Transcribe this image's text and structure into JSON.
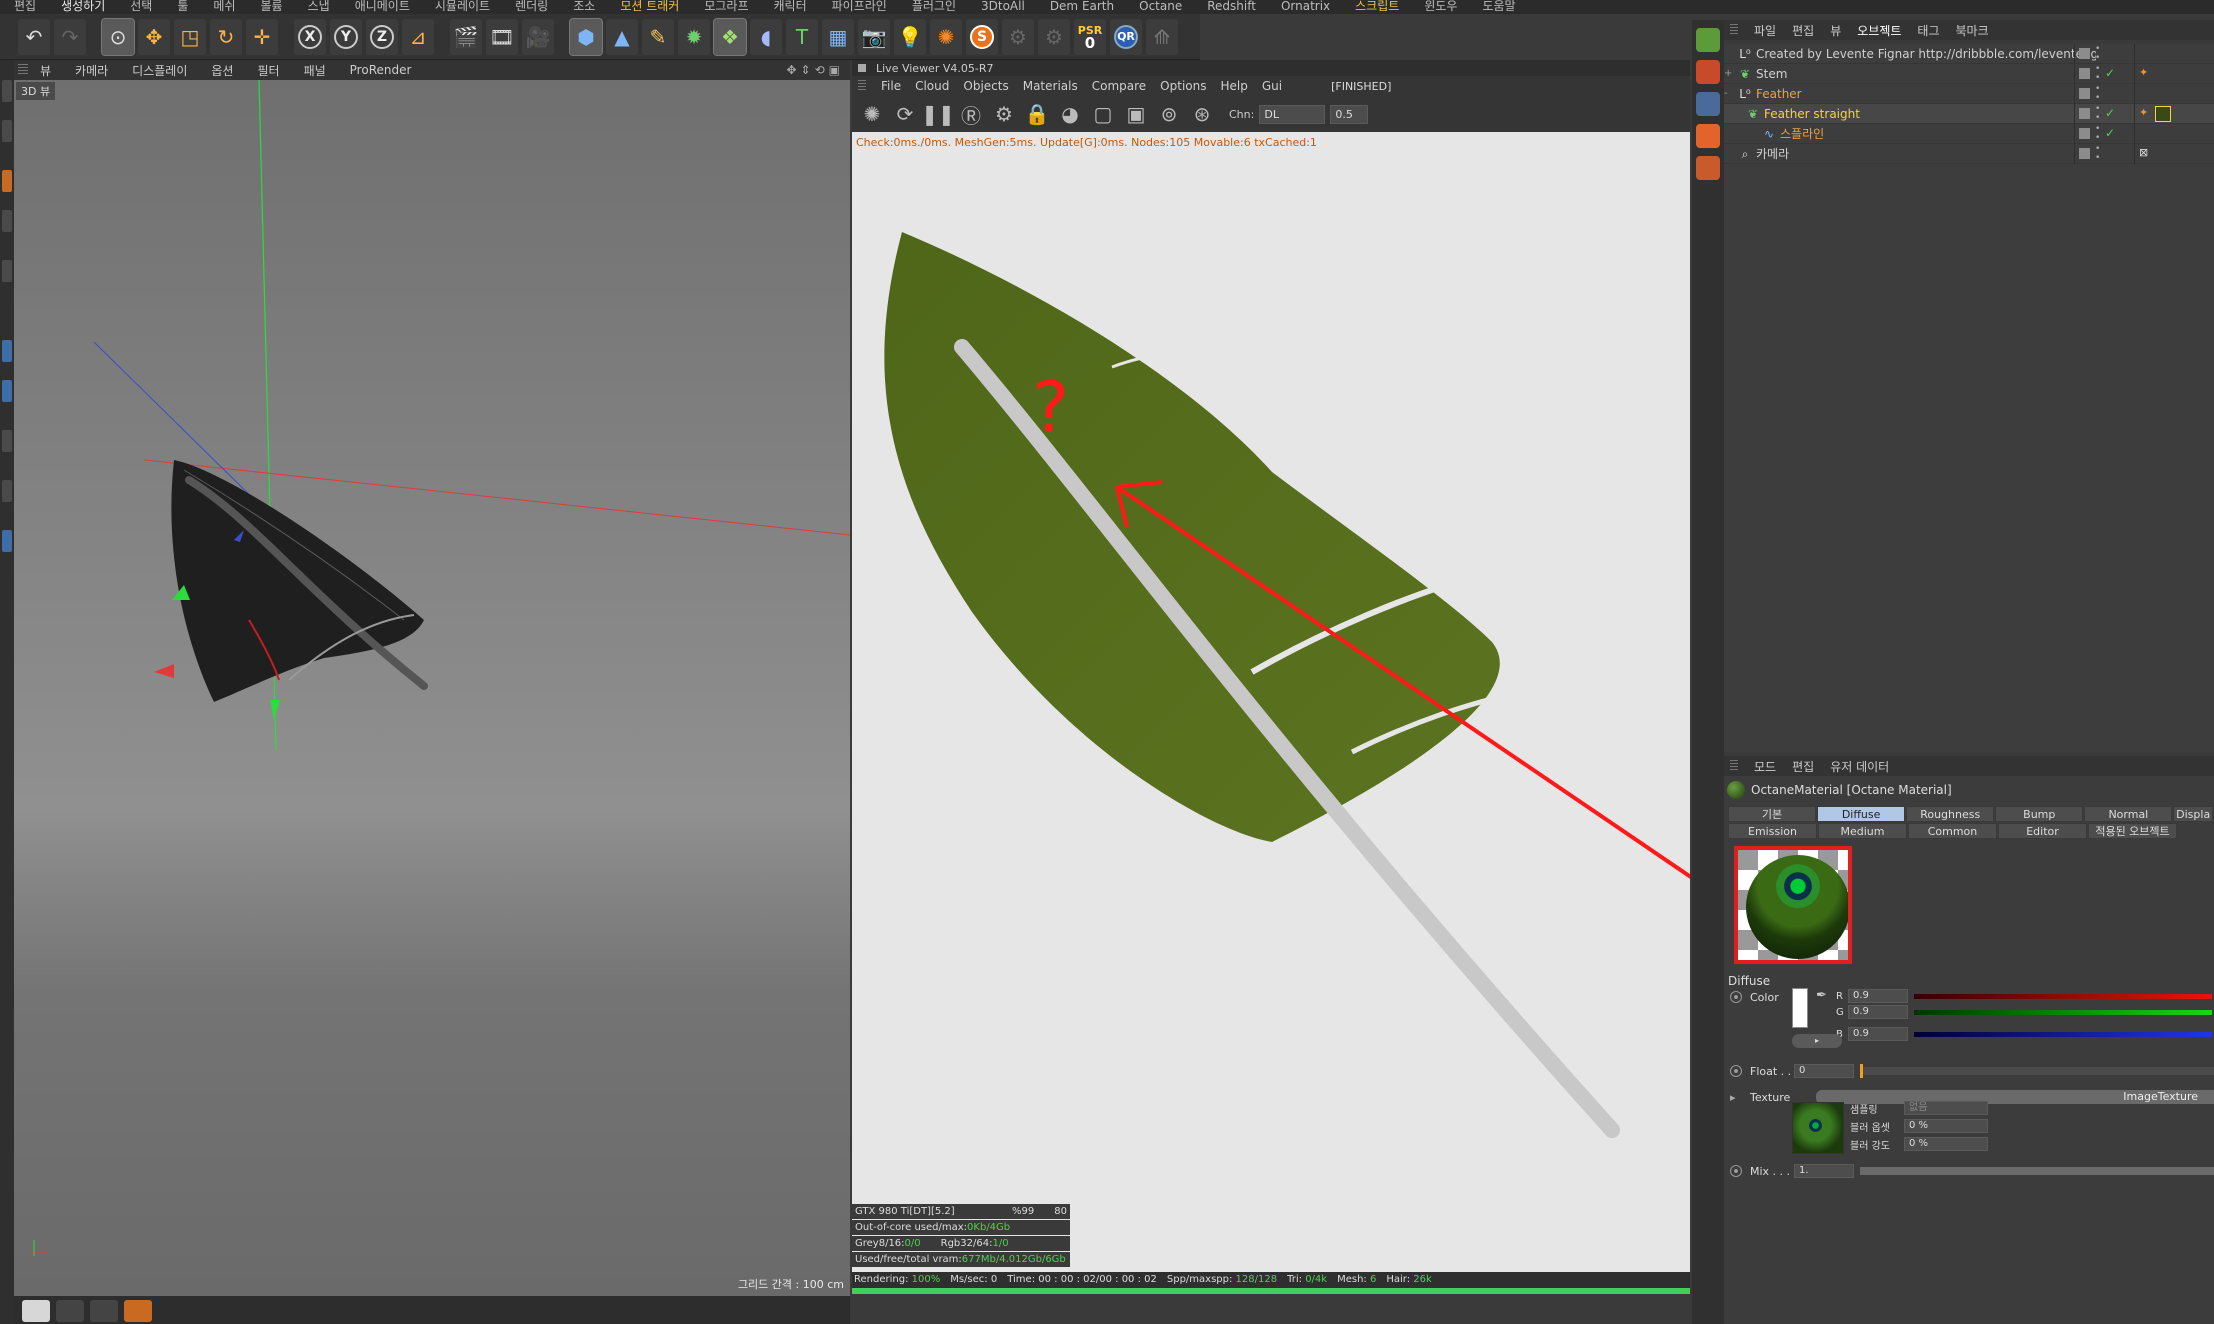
{
  "menubar": [
    "편집",
    "생성하기",
    "선택",
    "툴",
    "메쉬",
    "볼륨",
    "스냅",
    "애니메이트",
    "시뮬레이트",
    "렌더링",
    "조소",
    "모션 트래커",
    "모그라프",
    "캐릭터",
    "파이프라인",
    "플러그인",
    "3DtoAll",
    "Dem Earth",
    "Octane",
    "Redshift",
    "Ornatrix",
    "스크립트",
    "윈도우",
    "도움말"
  ],
  "toolbar": {
    "axis_x": "X",
    "axis_y": "Y",
    "axis_z": "Z",
    "psr_label": "PSR",
    "psr_value": "0",
    "qr_label": "QR",
    "s_label": "S"
  },
  "viewport": {
    "menu": [
      "뷰",
      "카메라",
      "디스플레이",
      "옵션",
      "필터",
      "패널",
      "ProRender"
    ],
    "label": "3D 뷰",
    "grid_text": "그리드 간격 : 100 cm"
  },
  "live_viewer": {
    "title": "Live Viewer V4.05-R7",
    "menu": [
      "File",
      "Cloud",
      "Objects",
      "Materials",
      "Compare",
      "Options",
      "Help",
      "Gui"
    ],
    "status_tag": "[FINISHED]",
    "chn_label": "Chn:",
    "chn_value": "DL",
    "chn_num": "0.5",
    "check_text": "Check:0ms./0ms. MeshGen:5ms. Update[G]:0ms. Nodes:105 Movable:6 txCached:1",
    "annotation": "?",
    "gpu": {
      "card": "GTX 980 Ti[DT][5.2]",
      "pct": "%99",
      "temp": "80",
      "ooc_label": "Out-of-core used/max:",
      "ooc_value": "0Kb/4Gb",
      "grey_label": "Grey8/16:",
      "grey_value": "0/0",
      "rgb_label": "Rgb32/64:",
      "rgb_value": "1/0",
      "vram_label": "Used/free/total vram:",
      "vram_value": "677Mb/4.012Gb/6Gb"
    },
    "status": {
      "rendering_label": "Rendering:",
      "rendering_value": "100%",
      "mssec_label": "Ms/sec:",
      "mssec_value": "0",
      "time_label": "Time:",
      "time_value": "00 : 00 : 02/00 : 00 : 02",
      "spp_label": "Spp/maxspp:",
      "spp_value": "128/128",
      "tri_label": "Tri:",
      "tri_value": "0/4k",
      "mesh_label": "Mesh:",
      "mesh_value": "6",
      "hair_label": "Hair:",
      "hair_value": "26k"
    }
  },
  "object_manager": {
    "menu": [
      "파일",
      "편집",
      "뷰",
      "오브젝트",
      "태그",
      "북마크"
    ],
    "rows": [
      {
        "name": "Created by Levente Fignar http://dribbble.com/leventefignar",
        "depth": 0,
        "icon": "null-icon",
        "expand": "",
        "color": "normal"
      },
      {
        "name": "Stem",
        "depth": 0,
        "icon": "spline-object-icon",
        "expand": "+",
        "color": "normal"
      },
      {
        "name": "Feather",
        "depth": 0,
        "icon": "null-icon",
        "expand": "-",
        "color": "orange"
      },
      {
        "name": "Feather straight",
        "depth": 1,
        "icon": "hair-object-icon",
        "expand": "-",
        "color": "yellow"
      },
      {
        "name": "스플라인",
        "depth": 2,
        "icon": "spline-icon",
        "expand": "",
        "color": "orange"
      },
      {
        "name": "카메라",
        "depth": 0,
        "icon": "camera-icon",
        "expand": "",
        "color": "normal"
      }
    ]
  },
  "attribute_manager": {
    "menu": [
      "모드",
      "편집",
      "유저 데이터"
    ],
    "title": "OctaneMaterial [Octane Material]",
    "tabs_row1": [
      "기본",
      "Diffuse",
      "Roughness",
      "Bump",
      "Normal",
      "Displa"
    ],
    "tabs_row2": [
      "Emission",
      "Medium",
      "Common",
      "Editor",
      "적용된 오브젝트"
    ],
    "active_tab": "Diffuse",
    "section": "Diffuse",
    "color_label": "Color",
    "r_label": "R",
    "r_value": "0.9",
    "g_label": "G",
    "g_value": "0.9",
    "b_label": "B",
    "b_value": "0.9",
    "float_label": "Float . .",
    "float_value": "0",
    "texture_label": "Texture",
    "texture_value": "ImageTexture",
    "sampling_label": "샘플링",
    "sampling_value": "없음",
    "blur_offset_label": "블러 옵셋",
    "blur_offset_value": "0 %",
    "blur_strength_label": "블러 강도",
    "blur_strength_value": "0 %",
    "mix_label": "Mix . . .",
    "mix_value": "1."
  }
}
